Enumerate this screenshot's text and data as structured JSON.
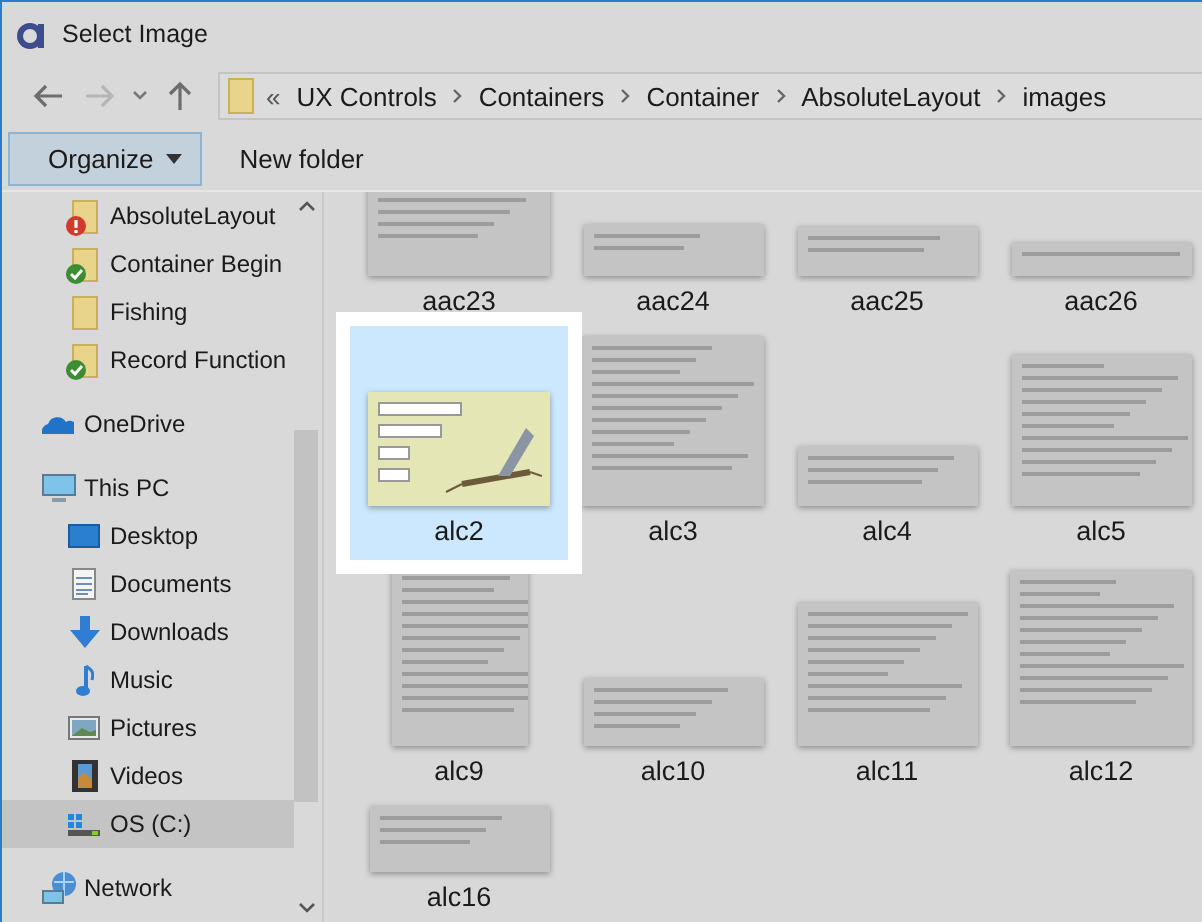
{
  "window": {
    "title": "Select Image"
  },
  "navigation": {
    "back": {
      "disabled": false
    },
    "forward": {
      "disabled": true
    },
    "up": {
      "disabled": false
    }
  },
  "address_bar": {
    "overflow": "«",
    "path": [
      "UX Controls",
      "Containers",
      "Container",
      "AbsoluteLayout",
      "images"
    ]
  },
  "toolbar": {
    "buttons": [
      {
        "label": "Organize",
        "kind": "menu",
        "highlighted": true
      },
      {
        "label": "New folder",
        "kind": "plain",
        "highlighted": false
      }
    ]
  },
  "sidebar": {
    "items": [
      {
        "label": "AbsoluteLayout",
        "kind": "folder",
        "error": true,
        "synced": false,
        "selected": false
      },
      {
        "label": "Container Begin",
        "kind": "folder",
        "error": false,
        "synced": true,
        "selected": false
      },
      {
        "label": "Fishing",
        "kind": "folder",
        "error": false,
        "synced": false,
        "selected": false
      },
      {
        "label": "Record Function",
        "kind": "folder",
        "error": false,
        "synced": true,
        "selected": false
      },
      {
        "label": "OneDrive",
        "kind": "cloud",
        "error": false,
        "synced": false,
        "selected": false
      },
      {
        "label": "This PC",
        "kind": "pc",
        "error": false,
        "synced": false,
        "selected": false,
        "children": [
          {
            "label": "Desktop",
            "kind": "desktop",
            "error": false,
            "synced": false,
            "selected": false
          },
          {
            "label": "Documents",
            "kind": "documents",
            "error": false,
            "synced": false,
            "selected": false
          },
          {
            "label": "Downloads",
            "kind": "downloads",
            "error": false,
            "synced": false,
            "selected": false
          },
          {
            "label": "Music",
            "kind": "music",
            "error": false,
            "synced": false,
            "selected": false
          },
          {
            "label": "Pictures",
            "kind": "pictures",
            "error": false,
            "synced": false,
            "selected": false
          },
          {
            "label": "Videos",
            "kind": "videos",
            "error": false,
            "synced": false,
            "selected": false
          },
          {
            "label": "OS (C:)",
            "kind": "drive",
            "error": false,
            "synced": false,
            "selected": true
          }
        ]
      },
      {
        "label": "Network",
        "kind": "network",
        "error": false,
        "synced": false,
        "selected": false
      }
    ]
  },
  "files": [
    {
      "name": "aac23",
      "kind": "screenshot",
      "selected": false
    },
    {
      "name": "aac24",
      "kind": "screenshot",
      "selected": false
    },
    {
      "name": "aac25",
      "kind": "screenshot",
      "selected": false
    },
    {
      "name": "aac26",
      "kind": "screenshot",
      "selected": false
    },
    {
      "name": "alc2",
      "kind": "photo",
      "selected": true
    },
    {
      "name": "alc3",
      "kind": "screenshot",
      "selected": false
    },
    {
      "name": "alc4",
      "kind": "screenshot",
      "selected": false
    },
    {
      "name": "alc5",
      "kind": "screenshot",
      "selected": false
    },
    {
      "name": "alc9",
      "kind": "screenshot",
      "selected": false
    },
    {
      "name": "alc10",
      "kind": "screenshot",
      "selected": false
    },
    {
      "name": "alc11",
      "kind": "screenshot",
      "selected": false
    },
    {
      "name": "alc12",
      "kind": "screenshot",
      "selected": false
    },
    {
      "name": "alc16",
      "kind": "screenshot",
      "selected": false
    }
  ]
}
